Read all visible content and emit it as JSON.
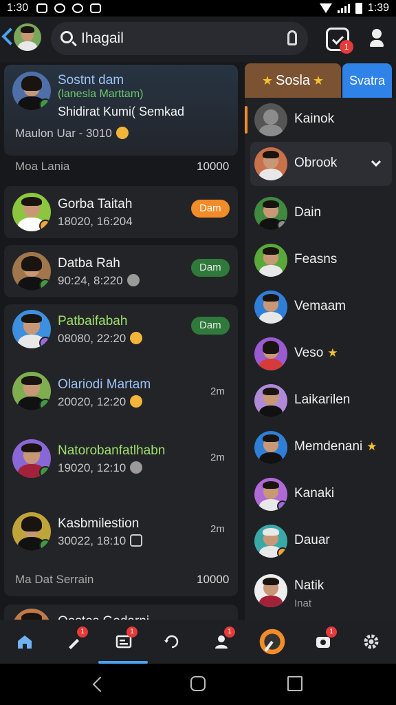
{
  "status_bar": {
    "time": "1:30",
    "battery": "1:39"
  },
  "search": {
    "value": "Ihagail"
  },
  "header": {
    "notification_count": "1"
  },
  "chats": {
    "featured": {
      "name": "Sostnt dam",
      "subtitle": "(lanesla Marttam)",
      "snippet": "Shidirat Kumi( Semkad",
      "meta": "Maulon Uar - 3010"
    },
    "divider_top": {
      "left": "Moa Lania",
      "right": "10000"
    },
    "items": [
      {
        "name": "Gorba Taitah",
        "time": "18020, 16:204",
        "pill": "Dam"
      },
      {
        "name": "Datba Rah",
        "time": "90:24, 8:220",
        "pill": "Dam"
      },
      {
        "name": "Patbaifabah",
        "time": "08080, 22:20",
        "pill": "Dam"
      },
      {
        "name": "Olariodi Martam",
        "time": "20020, 12:20",
        "ago": "2m"
      },
      {
        "name": "Natorobanfatlhabn",
        "time": "19020, 12:10",
        "ago": "2m"
      },
      {
        "name": "Kasbmilestion",
        "time": "30022, 18:10",
        "ago": "2m"
      },
      {
        "name": "Oostos Godarni"
      }
    ],
    "divider_bottom": {
      "left": "Ma Dat Serrain",
      "right": "10000"
    }
  },
  "panel": {
    "tab_social": "Sosla",
    "tab_2": "Svatra",
    "items": [
      {
        "label": "Kainok"
      },
      {
        "label": "Obrook"
      },
      {
        "label": "Dain"
      },
      {
        "label": "Feasns"
      },
      {
        "label": "Vemaam"
      },
      {
        "label": "Veso"
      },
      {
        "label": "Laikarilen"
      },
      {
        "label": "Memdenani"
      },
      {
        "label": "Kanaki"
      },
      {
        "label": "Dauar"
      },
      {
        "label": "Natik",
        "sub": "Inat"
      }
    ]
  },
  "bottom_nav": {
    "items": [
      {
        "icon": "home-icon"
      },
      {
        "icon": "pen-icon",
        "badge": "1"
      },
      {
        "icon": "news-icon",
        "badge": "1"
      },
      {
        "icon": "refresh-icon"
      },
      {
        "icon": "contacts-icon",
        "badge": "1"
      },
      {
        "icon": "chat-icon"
      },
      {
        "icon": "camera-icon",
        "badge": "1"
      },
      {
        "icon": "settings-icon"
      }
    ]
  }
}
